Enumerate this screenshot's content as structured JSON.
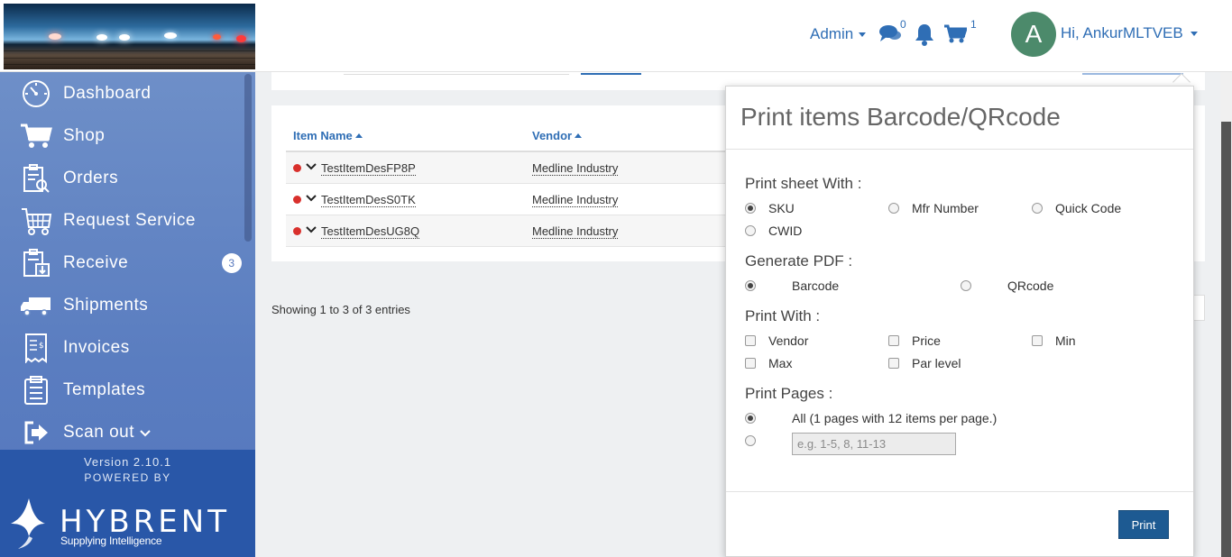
{
  "header": {
    "admin_label": "Admin",
    "messages_count": "0",
    "cart_count": "1",
    "avatar_initial": "A",
    "greeting": "Hi, AnkurMLTVEB"
  },
  "sidebar": {
    "items": [
      {
        "label": "Dashboard",
        "icon": "dashboard-icon"
      },
      {
        "label": "Shop",
        "icon": "cart-icon"
      },
      {
        "label": "Orders",
        "icon": "orders-icon"
      },
      {
        "label": "Request Service",
        "icon": "request-service-icon"
      },
      {
        "label": "Receive",
        "icon": "receive-icon",
        "count": "3"
      },
      {
        "label": "Shipments",
        "icon": "truck-icon"
      },
      {
        "label": "Invoices",
        "icon": "invoice-icon"
      },
      {
        "label": "Templates",
        "icon": "templates-icon"
      },
      {
        "label": "Scan out",
        "icon": "scan-out-icon"
      }
    ],
    "version": "Version 2.10.1",
    "powered_by": "POWERED BY",
    "brand": "HYBRENT",
    "tagline": "Supplying Intelligence"
  },
  "table": {
    "columns": [
      "Item Name",
      "Vendor"
    ],
    "rows": [
      {
        "item": "TestItemDesFP8P",
        "vendor": "Medline Industry"
      },
      {
        "item": "TestItemDesS0TK",
        "vendor": "Medline Industry"
      },
      {
        "item": "TestItemDesUG8Q",
        "vendor": "Medline Industry"
      }
    ],
    "showing": "Showing 1 to 3 of 3 entries"
  },
  "popover": {
    "title": "Print items Barcode/QRcode",
    "print_sheet_label": "Print sheet With :",
    "print_sheet_options": [
      "SKU",
      "Mfr Number",
      "Quick Code",
      "CWID"
    ],
    "print_sheet_selected": "SKU",
    "generate_pdf_label": "Generate PDF :",
    "pdf_options": [
      "Barcode",
      "QRcode"
    ],
    "pdf_selected": "Barcode",
    "print_with_label": "Print With :",
    "print_with_options": [
      "Vendor",
      "Price",
      "Min",
      "Max",
      "Par level"
    ],
    "print_pages_label": "Print Pages :",
    "all_pages_label": "All (1 pages with 12 items per page.)",
    "range_placeholder": "e.g. 1-5, 8, 11-13",
    "print_button": "Print"
  },
  "colors": {
    "accent": "#2f6eb5",
    "sidebar": "#5a7dc0",
    "footer": "#2957a8",
    "print_button": "#1d5a92",
    "status_dot": "#d9302c"
  }
}
